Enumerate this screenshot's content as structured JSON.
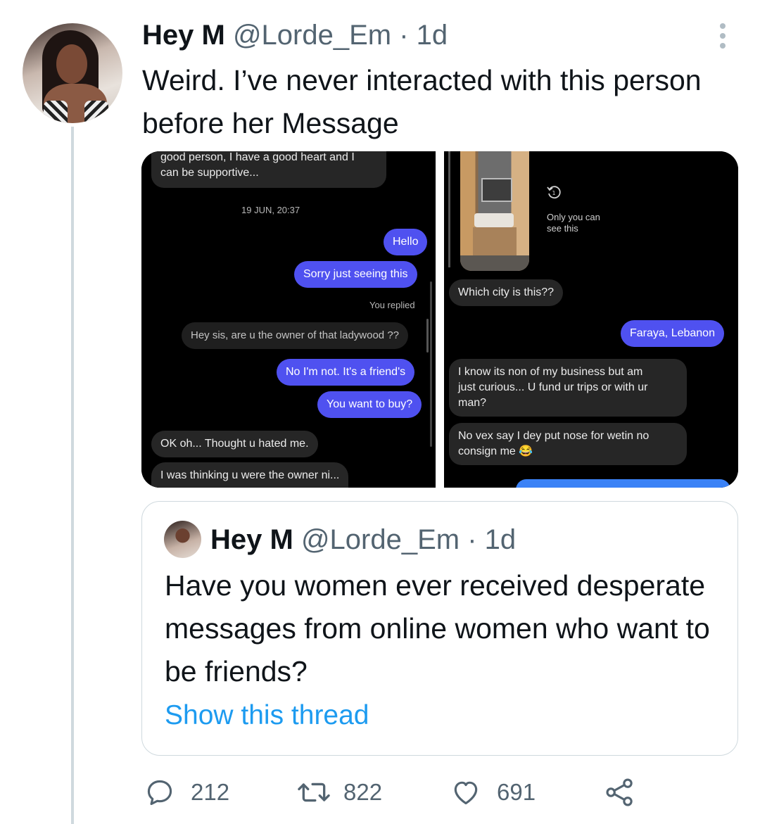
{
  "tweet": {
    "display_name": "Hey M",
    "handle": "@Lorde_Em",
    "separator": "·",
    "time": "1d",
    "text": "Weird. I’ve never interacted with this person before her Message"
  },
  "media": {
    "left_screenshot": {
      "messages": [
        {
          "side": "in",
          "text": "good person, I have a good heart and I"
        },
        {
          "side": "in",
          "text": "can be supportive..."
        },
        {
          "side": "meta",
          "text": "19 JUN, 20:37"
        },
        {
          "side": "out",
          "text": "Hello"
        },
        {
          "side": "out",
          "text": "Sorry just seeing this"
        },
        {
          "side": "meta",
          "text": "You replied"
        },
        {
          "side": "in",
          "text": "Hey sis, are u the owner of that ladywood ??"
        },
        {
          "side": "out",
          "text": "No I'm not. It's a friend's"
        },
        {
          "side": "out",
          "text": "You want to buy?"
        },
        {
          "side": "in",
          "text": "OK oh... Thought u hated me."
        },
        {
          "side": "in",
          "text": "I was thinking u were the owner ni..."
        }
      ]
    },
    "right_screenshot": {
      "view_once_label_1": "Only you can",
      "view_once_label_2": "see this",
      "messages": [
        {
          "side": "in",
          "text": "Which city is this??"
        },
        {
          "side": "out",
          "text": "Faraya, Lebanon"
        },
        {
          "side": "in",
          "text": "I know its non of my business but am"
        },
        {
          "side": "in",
          "text": "just curious... U fund ur trips or with ur"
        },
        {
          "side": "in",
          "text": "man?"
        },
        {
          "side": "in",
          "text": "No vex say I dey put nose for wetin no"
        },
        {
          "side": "in",
          "text": "consign me 😂"
        }
      ]
    }
  },
  "quote": {
    "display_name": "Hey M",
    "handle": "@Lorde_Em",
    "separator": "·",
    "time": "1d",
    "text": "Have you women ever received desperate messages from online women who want to be friends?",
    "link": "Show this thread"
  },
  "actions": {
    "reply_count": "212",
    "retweet_count": "822",
    "like_count": "691",
    "icons": [
      "reply-icon",
      "retweet-icon",
      "like-icon",
      "share-icon"
    ]
  },
  "colors": {
    "link": "#1d9bf0",
    "secondary_text": "#536471",
    "outgoing_bubble": "#4f51f0",
    "incoming_bubble": "#262626"
  }
}
